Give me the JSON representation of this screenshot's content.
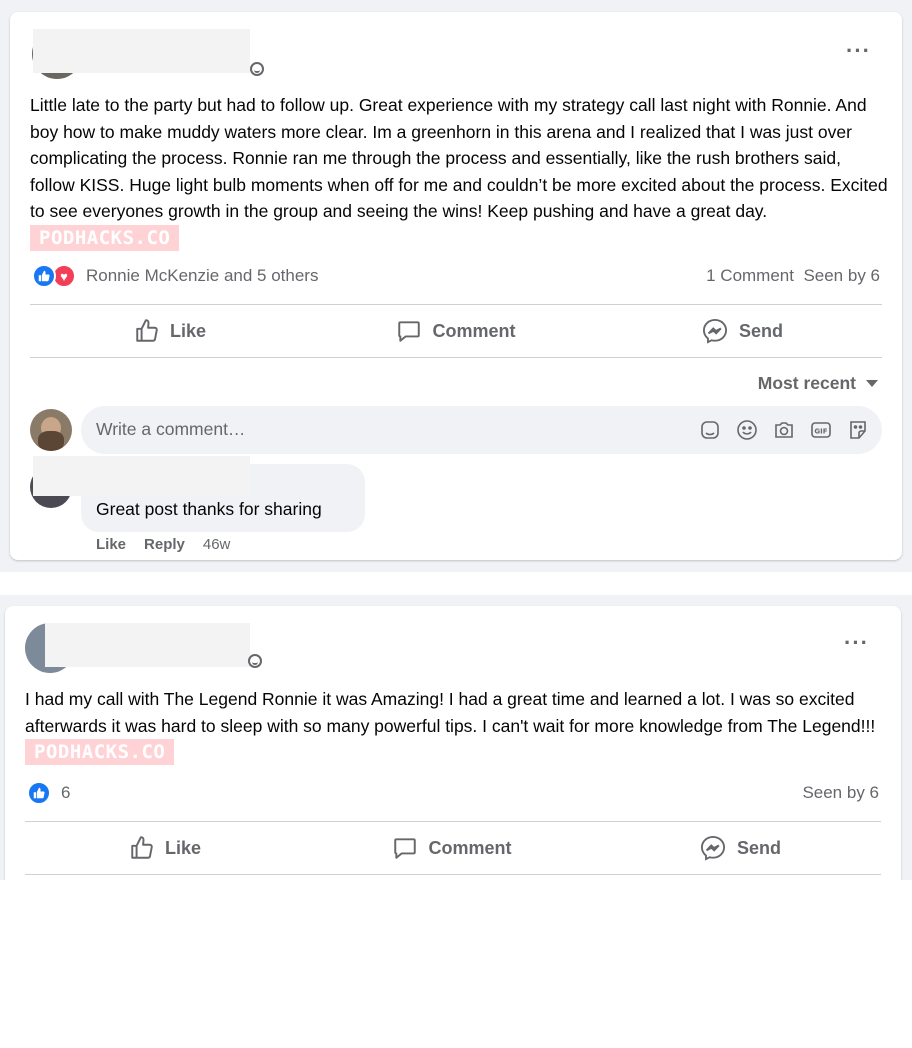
{
  "posts": [
    {
      "text": "Little late to the party but had to follow up. Great experience with my strategy call last night with Ronnie. And boy how to make muddy waters more clear. Im a greenhorn in this arena and I realized that I was just over complicating the process. Ronnie ran me through the process and essentially, like the rush brothers said, follow KISS. Huge light bulb moments when off for me and couldn’t be more excited about the process. Excited to see everyones growth in the group and seeing the wins! Keep pushing and have a great day.",
      "watermark": "PODHACKS.CO",
      "reactions_text": "Ronnie McKenzie and 5 others",
      "comments_count": "1 Comment",
      "seen_by": "Seen by 6",
      "actions": {
        "like": "Like",
        "comment": "Comment",
        "send": "Send"
      },
      "sort_label": "Most recent",
      "comment_placeholder": "Write a comment…",
      "comment": {
        "text": "Great post thanks for sharing",
        "like": "Like",
        "reply": "Reply",
        "time": "46w"
      }
    },
    {
      "text": "I had my call with The Legend Ronnie it was Amazing!  I had a great time and learned a lot. I was so excited afterwards it was hard to sleep with so many powerful tips. I can't wait for more knowledge from The Legend!!!",
      "watermark": "PODHACKS.CO",
      "reactions_count": "6",
      "seen_by": "Seen by 6",
      "actions": {
        "like": "Like",
        "comment": "Comment",
        "send": "Send"
      }
    }
  ],
  "icons": [
    "more-options-icon",
    "globe-icon",
    "like-reaction-icon",
    "love-reaction-icon",
    "thumbs-up-icon",
    "comment-icon",
    "messenger-icon",
    "caret-down-icon",
    "sticker-icon",
    "emoji-icon",
    "camera-icon",
    "gif-icon",
    "avatar-sticker-icon"
  ],
  "colors": {
    "accent": "#1877f2",
    "love": "#f33e58",
    "secondary_text": "#65676b",
    "background": "#f0f2f5",
    "watermark": "#ffd3d6"
  }
}
